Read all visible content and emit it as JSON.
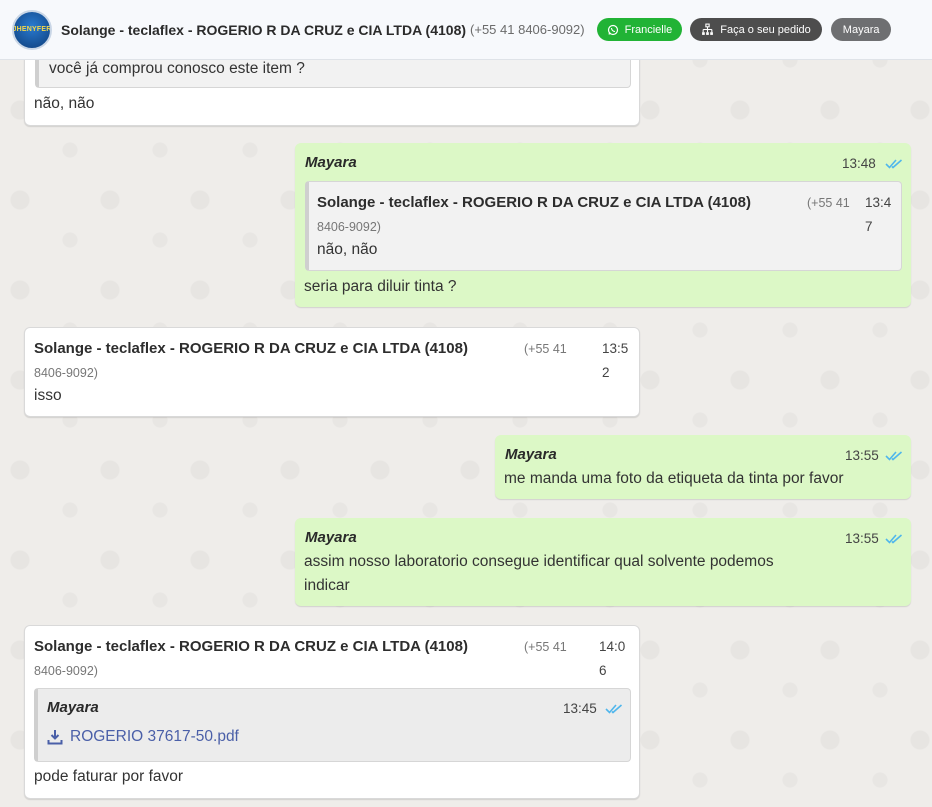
{
  "header": {
    "avatar_text": "JHENYFER",
    "contact_name": "Solange - teclaflex - ROGERIO R DA CRUZ e CIA LTDA (4108)",
    "contact_phone": "(+55 41 8406-9092)",
    "btn_whatsapp": "Francielle",
    "btn_order": "Faça o seu pedido",
    "btn_user": "Mayara",
    "colors": {
      "whatsapp": "#21b335",
      "order": "#4d4d4d",
      "user": "#6e6f71"
    }
  },
  "messages": [
    {
      "quote_text": "você já comprou conosco este item ?",
      "text": "não, não"
    },
    {
      "agent": "Mayara",
      "time": "13:48",
      "quote": {
        "sender": "Solange - teclaflex - ROGERIO R DA CRUZ e CIA LTDA (4108)",
        "phone_a": "(+55 41",
        "phone_b": "8406-9092)",
        "time_a": "13:4",
        "time_b": "7",
        "text": "não, não"
      },
      "text": "seria para diluir tinta ?"
    },
    {
      "sender": "Solange - teclaflex - ROGERIO R DA CRUZ e CIA LTDA (4108)",
      "phone_a": "(+55 41",
      "phone_b": "8406-9092)",
      "time_a": "13:5",
      "time_b": "2",
      "text": "isso"
    },
    {
      "agent": "Mayara",
      "time": "13:55",
      "text": "me manda uma foto da etiqueta da tinta por favor"
    },
    {
      "agent": "Mayara",
      "time": "13:55",
      "text_a": "assim nosso laboratorio consegue identificar qual solvente podemos",
      "text_b": "indicar"
    },
    {
      "sender": "Solange - teclaflex - ROGERIO R DA CRUZ e CIA LTDA (4108)",
      "phone_a": "(+55 41",
      "phone_b": "8406-9092)",
      "time_a": "14:0",
      "time_b": "6",
      "quote": {
        "agent": "Mayara",
        "time": "13:45",
        "file": "ROGERIO 37617-50.pdf"
      },
      "text": "pode faturar por favor"
    }
  ],
  "icons": {
    "download": "download-icon",
    "read_ticks": "double-check-icon",
    "whatsapp": "whatsapp-icon",
    "order": "sitemap-icon"
  },
  "tick_color": "#4fb6ec"
}
